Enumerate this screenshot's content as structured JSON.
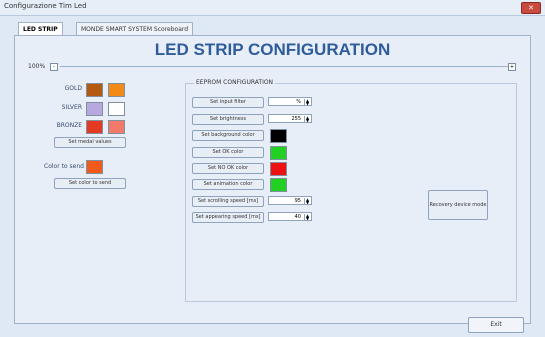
{
  "window": {
    "title": "Configurazione Tim Led",
    "close_glyph": "✕"
  },
  "tabs": [
    {
      "label": "LED STRIP",
      "active": true
    },
    {
      "label": "MONDE SMART SYSTEM Scoreboard",
      "active": false
    }
  ],
  "heading": "LED STRIP CONFIGURATION",
  "zoom": {
    "left_label": "100%",
    "minus": "-",
    "plus": "+"
  },
  "medals": {
    "gold_label": "GOLD",
    "silver_label": "SILVER",
    "bronze_label": "BRONZE",
    "gold_colors": [
      "#b35a10",
      "#f28a1a"
    ],
    "silver_colors": [
      "#b7a9e0",
      "#ffffff"
    ],
    "bronze_colors": [
      "#e53a22",
      "#f17a6a"
    ],
    "set_button": "Set medal values"
  },
  "send": {
    "label": "Color to send",
    "color": "#f05a1a",
    "button": "Set color to send"
  },
  "eeprom": {
    "title": "EEPROM CONFIGURATION",
    "rows": [
      {
        "button": "Set input filter",
        "value": "%"
      },
      {
        "button": "Set brightness",
        "value": "255"
      },
      {
        "button": "Set background color",
        "color": "#000000"
      },
      {
        "button": "Set OK color",
        "color": "#22d022"
      },
      {
        "button": "Set NO OK color",
        "color": "#ee1111"
      },
      {
        "button": "Set animation color",
        "color": "#22d022"
      },
      {
        "button": "Set scrolling speed [ms]",
        "value": "95"
      },
      {
        "button": "Set appearing speed [ms]",
        "value": "40"
      }
    ],
    "recovery_button": "Recovery device mode"
  },
  "exit_button": "Exit"
}
